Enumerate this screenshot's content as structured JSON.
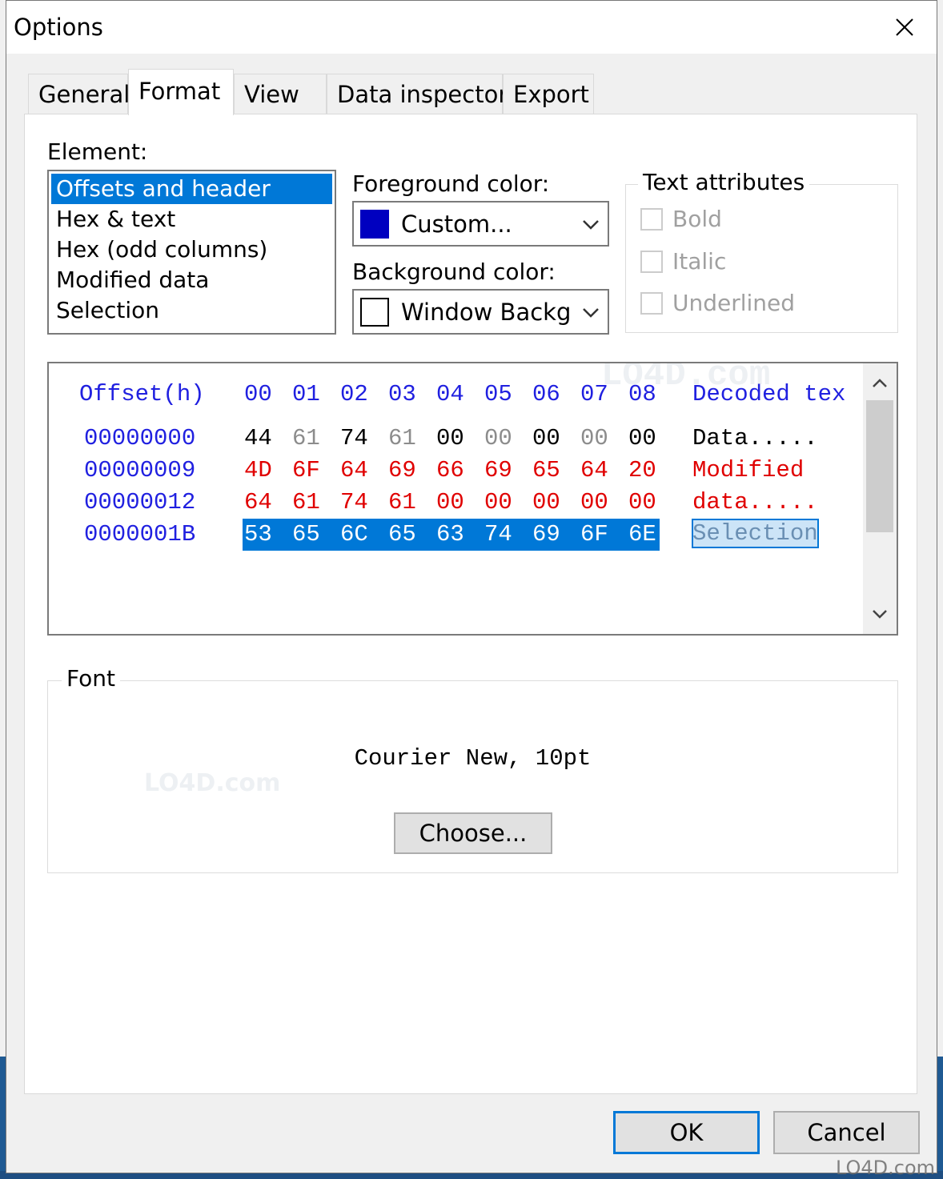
{
  "window": {
    "title": "Options"
  },
  "tabs": [
    {
      "label": "General"
    },
    {
      "label": "Format"
    },
    {
      "label": "View"
    },
    {
      "label": "Data inspector"
    },
    {
      "label": "Export"
    }
  ],
  "element": {
    "label": "Element:",
    "items": [
      "Offsets and header",
      "Hex & text",
      "Hex (odd columns)",
      "Modified data",
      "Selection"
    ],
    "selected": "Offsets and header"
  },
  "foreground": {
    "label": "Foreground color:",
    "value": "Custom...",
    "swatch_color": "#0000c0"
  },
  "background": {
    "label": "Background color:",
    "value": "Window Background",
    "swatch_color": "#ffffff"
  },
  "text_attributes": {
    "title": "Text attributes",
    "bold": "Bold",
    "italic": "Italic",
    "underlined": "Underlined"
  },
  "preview": {
    "header": {
      "offset": "Offset(h)",
      "columns": [
        "00",
        "01",
        "02",
        "03",
        "04",
        "05",
        "06",
        "07",
        "08"
      ],
      "decoded": "Decoded tex"
    },
    "rows": [
      {
        "offset": "00000000",
        "bytes": [
          "44",
          "61",
          "74",
          "61",
          "00",
          "00",
          "00",
          "00",
          "00"
        ],
        "text": "Data....."
      },
      {
        "offset": "00000009",
        "bytes": [
          "4D",
          "6F",
          "64",
          "69",
          "66",
          "69",
          "65",
          "64",
          "20"
        ],
        "text": "Modified "
      },
      {
        "offset": "00000012",
        "bytes": [
          "64",
          "61",
          "74",
          "61",
          "00",
          "00",
          "00",
          "00",
          "00"
        ],
        "text": "data....."
      },
      {
        "offset": "0000001B",
        "bytes": [
          "53",
          "65",
          "6C",
          "65",
          "63",
          "74",
          "69",
          "6F",
          "6E"
        ],
        "text": "Selection"
      }
    ]
  },
  "font": {
    "title": "Font",
    "value": "Courier New, 10pt",
    "choose_label": "Choose..."
  },
  "buttons": {
    "ok": "OK",
    "cancel": "Cancel"
  },
  "watermark": {
    "text": "LO4D.com"
  },
  "colors": {
    "accent": "#0078d7",
    "header_blue": "#2020e0",
    "modified_red": "#e00000"
  }
}
